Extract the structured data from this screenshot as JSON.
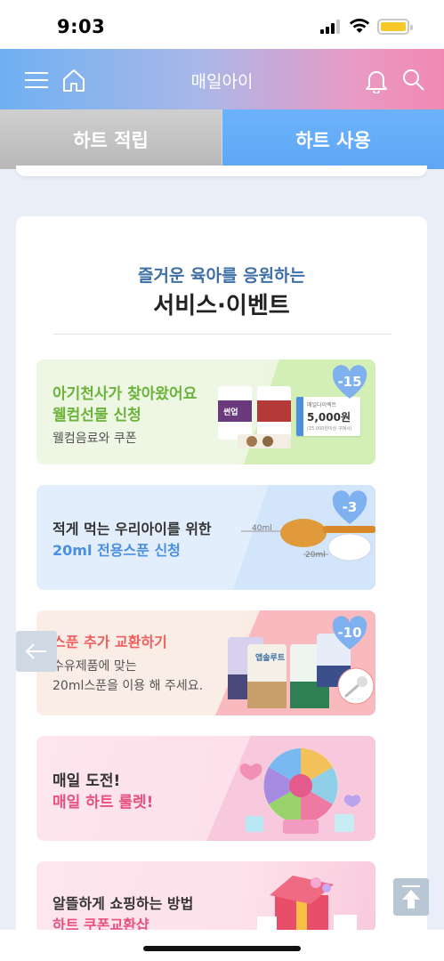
{
  "status_bar": {
    "time": "9:03"
  },
  "header": {
    "title": "매일아이",
    "gradient": [
      "#6fb0f2",
      "#f088b3"
    ]
  },
  "tabs": [
    {
      "label": "하트 적립",
      "active": false
    },
    {
      "label": "하트 사용",
      "active": true
    }
  ],
  "section": {
    "subtitle": "즐거운 육아를 응원하는",
    "title": "서비스·이벤트"
  },
  "cards": [
    {
      "line1": "아기천사가 찾아왔어요",
      "line2": "웰컴선물 신청",
      "line3": "웰컴음료와 쿠폰",
      "badge": "-15",
      "coupon_label": "매일다이렉트",
      "coupon_value": "5,000원",
      "coupon_note": "(15,000원이상 구매시)",
      "product_label": "썬업"
    },
    {
      "line1": "적게 먹는 우리아이를 위한",
      "line2": "20ml 전용스푼 신청",
      "badge": "-3",
      "spoon_label_big": "40ml",
      "spoon_label_small": "20ml"
    },
    {
      "line1": "스푼 추가 교환하기",
      "line2": "수유제품에 맞는",
      "line3": "20ml스푼을 이용 해 주세요.",
      "badge": "-10",
      "product_label": "앱솔루트"
    },
    {
      "line1": "매일 도전!",
      "line2": "매일 하트 룰렛!"
    },
    {
      "line1": "알뜰하게 쇼핑하는 방법",
      "line2": "하트 쿠폰교환샵"
    }
  ],
  "colors": {
    "accent_green": "#6bb33a",
    "accent_blue": "#4a8fe0",
    "accent_red": "#ee5f5f",
    "accent_pink": "#e8507f",
    "badge_blue": "#7fb0f0"
  }
}
